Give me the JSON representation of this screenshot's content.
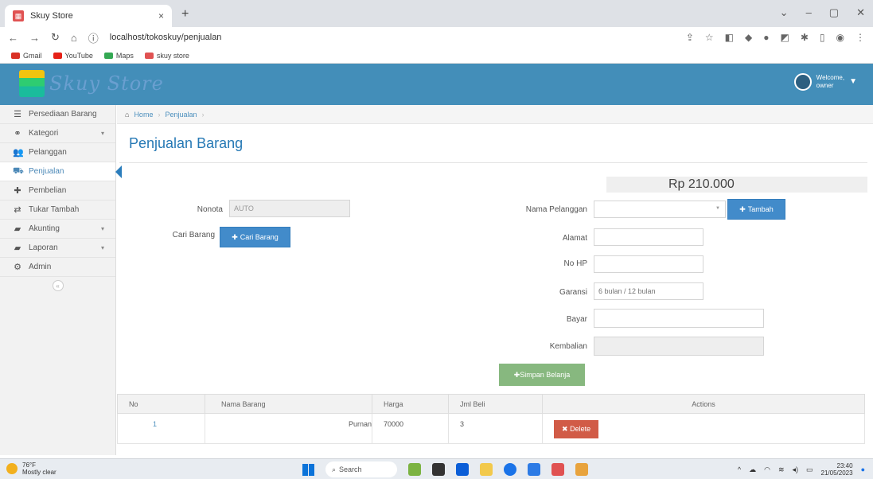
{
  "browser": {
    "tab_title": "Skuy Store",
    "tab_close": "×",
    "new_tab": "+",
    "url": "localhost/tokoskuy/penjualan",
    "bookmarks": [
      {
        "label": "Gmail",
        "color": "#d93025"
      },
      {
        "label": "YouTube",
        "color": "#e62117"
      },
      {
        "label": "Maps",
        "color": "#34a853"
      },
      {
        "label": "skuy store",
        "color": "#e05252"
      }
    ]
  },
  "header": {
    "brand": "Skuy Store",
    "welcome": "Welcome,",
    "user": "owner"
  },
  "sidebar": {
    "items": [
      {
        "label": "Persediaan Barang",
        "icon": "list-icon"
      },
      {
        "label": "Kategori",
        "icon": "tags-icon"
      },
      {
        "label": "Pelanggan",
        "icon": "users-icon"
      },
      {
        "label": "Penjualan",
        "icon": "cart-icon"
      },
      {
        "label": "Pembelian",
        "icon": "plus-icon"
      },
      {
        "label": "Tukar Tambah",
        "icon": "exchange-icon"
      },
      {
        "label": "Akunting",
        "icon": "book-icon"
      },
      {
        "label": "Laporan",
        "icon": "book-icon"
      },
      {
        "label": "Admin",
        "icon": "cogs-icon"
      }
    ]
  },
  "breadcrumb": {
    "home": "Home",
    "current": "Penjualan"
  },
  "page": {
    "title": "Penjualan Barang",
    "total": "Rp 210.000"
  },
  "form": {
    "nonota_label": "Nonota",
    "nonota_value": "AUTO",
    "cari_label": "Cari Barang",
    "cari_button": "Cari Barang",
    "nama_pelanggan_label": "Nama Pelanggan",
    "tambah_button": "Tambah",
    "alamat_label": "Alamat",
    "nohp_label": "No HP",
    "garansi_label": "Garansi",
    "garansi_placeholder": "6 bulan / 12 bulan",
    "bayar_label": "Bayar",
    "kembalian_label": "Kembalian",
    "simpan_button": "Simpan Belanja"
  },
  "table": {
    "headers": [
      "No",
      "Nama Barang",
      "Harga",
      "Jml Beli",
      "Actions"
    ],
    "rows": [
      {
        "no": "1",
        "nama": "Purnan",
        "harga": "70000",
        "jml": "3"
      }
    ],
    "delete_label": "Delete"
  },
  "taskbar": {
    "temp": "76°F",
    "weather": "Mostly clear",
    "search": "Search",
    "time": "23:40",
    "date": "21/05/2023"
  }
}
